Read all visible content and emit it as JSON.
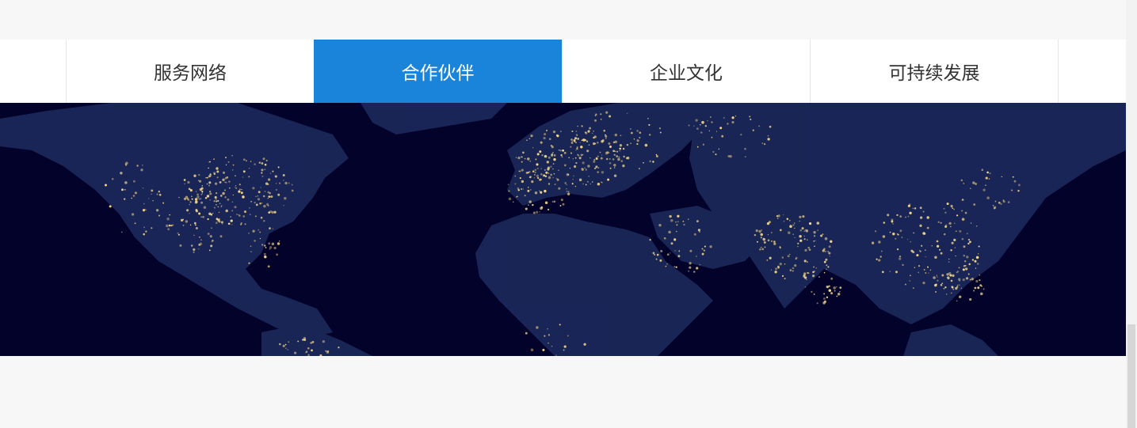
{
  "tabs": [
    {
      "label": "服务网络",
      "active": false
    },
    {
      "label": "合作伙伴",
      "active": true
    },
    {
      "label": "企业文化",
      "active": false
    },
    {
      "label": "可持续发展",
      "active": false
    }
  ],
  "colors": {
    "active_tab": "#1a84db",
    "map_ocean": "#03022a",
    "map_land": "#1c2a5c",
    "city_lights": "#f6d98a"
  },
  "map": {
    "icon": "world-night-lights-image"
  }
}
